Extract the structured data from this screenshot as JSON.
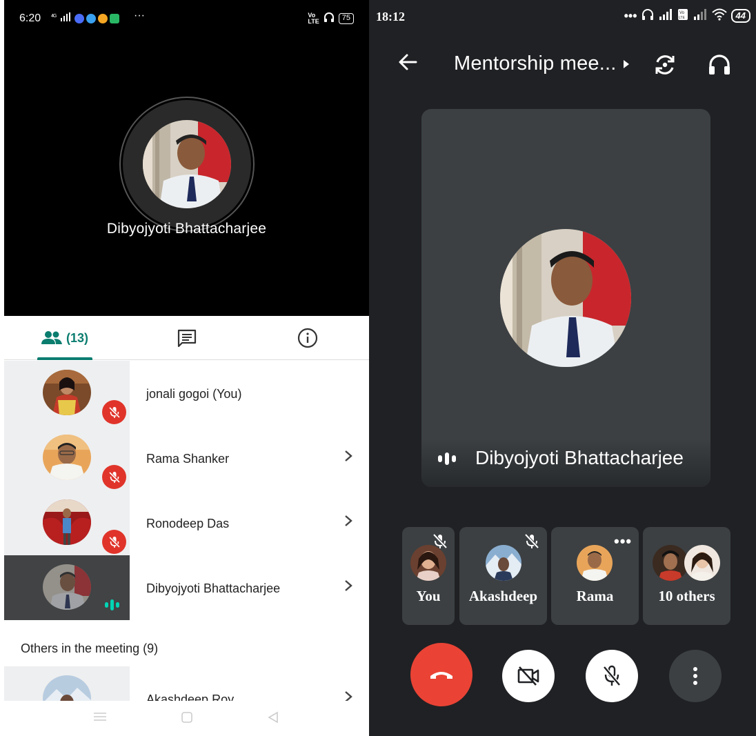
{
  "left_phone": {
    "status": {
      "time": "6:20",
      "signal_text": "⁰·⁴⁰",
      "overflow": "···",
      "lte_badge": "VoLTE",
      "battery": "75"
    },
    "active_speaker": {
      "name": "Dibyojyoti Bhattacharjee"
    },
    "tabs": {
      "people_count": "(13)"
    },
    "participants": [
      {
        "name": "jonali gogoi (You)",
        "muted": true
      },
      {
        "name": "Rama Shanker",
        "muted": true
      },
      {
        "name": "Ronodeep Das",
        "muted": true
      },
      {
        "name": "Dibyojyoti Bhattacharjee",
        "speaking": true
      }
    ],
    "others_heading": "Others in the meeting (9)",
    "partial_row_name": "Akashdeep Roy",
    "colors": {
      "accent": "#0b7d6f",
      "mute_badge": "#e0342a",
      "speaking": "#00d4b4"
    }
  },
  "right_phone": {
    "status": {
      "time": "18:12",
      "battery": "44"
    },
    "meeting_title": "Mentorship mee...",
    "speaker_name": "Dibyojyoti Bhattacharjee",
    "thumbnails": [
      {
        "label": "You",
        "muted": true
      },
      {
        "label": "Akashdeep",
        "muted": true
      },
      {
        "label": "Rama",
        "more": "•••"
      },
      {
        "label": "10 others"
      }
    ],
    "colors": {
      "background": "#202124",
      "tile": "#3c4043",
      "end_call": "#ea4335"
    }
  }
}
